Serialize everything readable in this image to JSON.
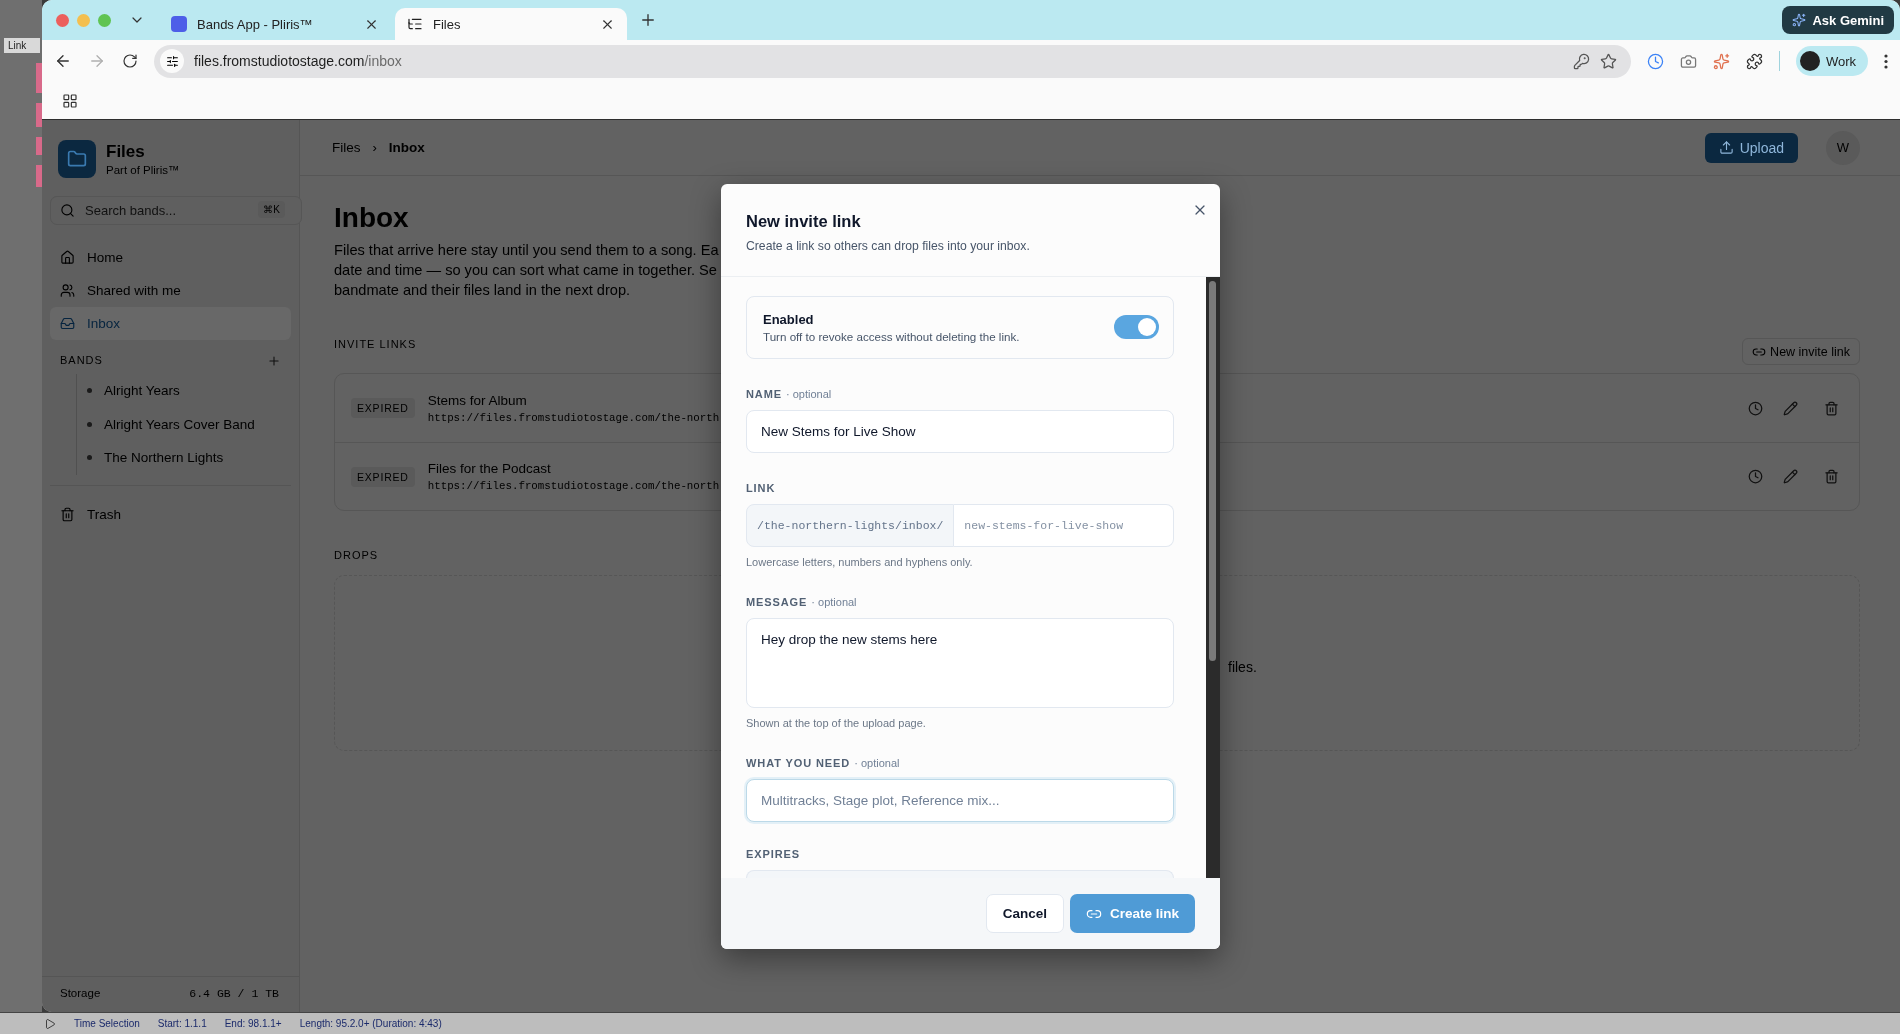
{
  "background_app": {
    "button": "Link",
    "status": [
      "Time Selection",
      "Start: 1.1.1",
      "End: 98.1.1+",
      "Length: 95.2.0+ (Duration: 4:43)"
    ]
  },
  "browser": {
    "tabs": [
      {
        "title": "Bands App - Pliris™",
        "selected": false
      },
      {
        "title": "Files",
        "selected": true
      }
    ],
    "ask_button": "Ask Gemini",
    "address": {
      "host": "files.fromstudiotostage.com",
      "path": "/inbox"
    },
    "forward_disabled": true,
    "profile": "Work"
  },
  "sidebar": {
    "app_name": "Files",
    "app_subtitle": "Part of Pliris™",
    "search": {
      "placeholder": "Search bands...",
      "shortcut": "⌘K"
    },
    "nav": [
      {
        "label": "Home",
        "selected": false
      },
      {
        "label": "Shared with me",
        "selected": false
      },
      {
        "label": "Inbox",
        "selected": true
      }
    ],
    "bands_heading": "BANDS",
    "bands": [
      {
        "label": "Alright Years"
      },
      {
        "label": "Alright Years Cover Band"
      },
      {
        "label": "The Northern Lights"
      }
    ],
    "trash": "Trash",
    "storage_label": "Storage",
    "storage_value": "6.4 GB / 1 TB"
  },
  "header": {
    "breadcrumb": [
      "Files",
      "Inbox"
    ],
    "breadcrumb_separator": "›",
    "upload": "Upload",
    "avatar": "W"
  },
  "page": {
    "title": "Inbox",
    "description": [
      "Files that arrive here stay until you send them to a song. Ea",
      "date and time — so you can sort what came in together. Se",
      "bandmate and their files land in the next drop."
    ],
    "invite_heading": "INVITE LINKS",
    "new_invite": "New invite link",
    "invite_links": [
      {
        "status": "EXPIRED",
        "name": "Stems for Album",
        "url": "https://files.fromstudiotostage.com/the-north"
      },
      {
        "status": "EXPIRED",
        "name": "Files for the Podcast",
        "url": "https://files.fromstudiotostage.com/the-north"
      }
    ],
    "drops_heading": "DROPS",
    "drops_empty": "files."
  },
  "modal": {
    "title": "New invite link",
    "subtitle": "Create a link so others can drop files into your inbox.",
    "enabled": {
      "label": "Enabled",
      "description": "Turn off to revoke access without deleting the link.",
      "on": true
    },
    "name": {
      "label": "NAME",
      "optional": "· optional",
      "value": "New Stems for Live Show"
    },
    "link": {
      "label": "LINK",
      "prefix": "/the-northern-lights/inbox/",
      "placeholder": "new-stems-for-live-show",
      "hint": "Lowercase letters, numbers and hyphens only."
    },
    "message": {
      "label": "MESSAGE",
      "optional": "· optional",
      "value": "Hey drop the new stems here",
      "hint": "Shown at the top of the upload page."
    },
    "needs": {
      "label": "WHAT YOU NEED",
      "optional": "· optional",
      "placeholder": "Multitracks, Stage plot, Reference mix...",
      "focused": true
    },
    "expires": {
      "label": "EXPIRES"
    },
    "cancel": "Cancel",
    "create": "Create link"
  }
}
